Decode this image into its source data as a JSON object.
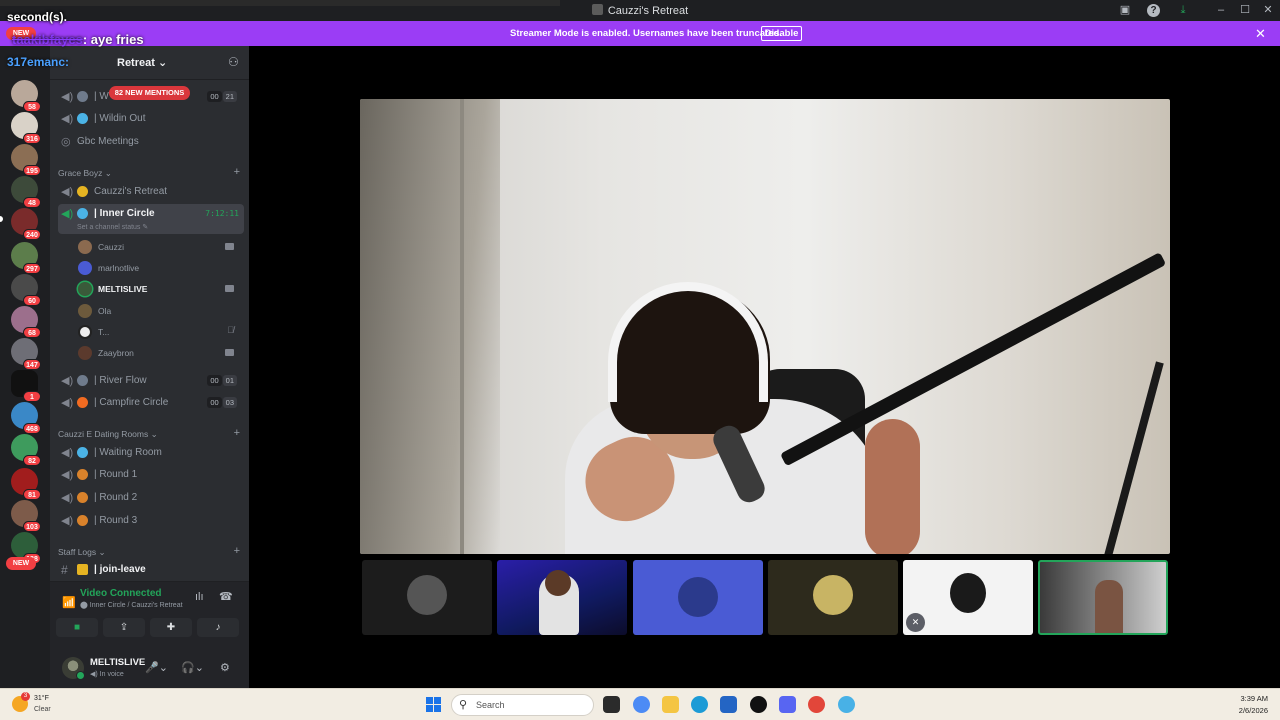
{
  "window": {
    "title": "Cauzzi's Retreat"
  },
  "banner": {
    "text": "Streamer Mode is enabled. Usernames have been truncated.",
    "button": "Disable",
    "color": "#9b3df5"
  },
  "overlay": {
    "line1": "second(s).",
    "line2_user": "taakibfayes",
    "line2_msg": "aye fries",
    "line3_user": "317emanc:"
  },
  "rail": {
    "badges": [
      "58",
      "316",
      "195",
      "48",
      "240",
      "297",
      "60",
      "68",
      "147",
      "1",
      "468",
      "82",
      "81",
      "103",
      "188"
    ],
    "new_label": "NEW"
  },
  "guild": {
    "name": "Retreat",
    "mentions": "82 NEW MENTIONS"
  },
  "channels_top": [
    {
      "name": "| W",
      "counts": [
        "00",
        "21"
      ]
    },
    {
      "name": "| Wildin Out"
    },
    {
      "name": "Gbc Meetings"
    }
  ],
  "categories": {
    "grace": "Grace Boyz",
    "dating": "Cauzzi E Dating Rooms",
    "staff": "Staff Logs"
  },
  "grace_channels": [
    {
      "name": "Cauzzi's Retreat"
    },
    {
      "name": "| Inner Circle",
      "timer": "7:12:11"
    }
  ],
  "channel_status": "Set a channel status",
  "voice_users": [
    {
      "name": "Cauzzi"
    },
    {
      "name": "marlnotlive"
    },
    {
      "name": "MELTISLIVE"
    },
    {
      "name": "Ola"
    },
    {
      "name": "T..."
    },
    {
      "name": "Zaaybron"
    }
  ],
  "more_channels": [
    {
      "name": "| River Flow",
      "counts": [
        "00",
        "01"
      ]
    },
    {
      "name": "| Campfire Circle",
      "counts": [
        "00",
        "03"
      ]
    }
  ],
  "dating_channels": [
    {
      "name": "| Waiting Room"
    },
    {
      "name": "| Round 1"
    },
    {
      "name": "| Round 2"
    },
    {
      "name": "| Round 3"
    }
  ],
  "staff_channels": [
    {
      "name": "| join-leave"
    }
  ],
  "voice_panel": {
    "status": "Video Connected",
    "sub": "Inner Circle / Cauzzi's Retreat"
  },
  "user_panel": {
    "name": "MELTISLIVE",
    "status": "In voice"
  },
  "taskbar": {
    "temp": "31°F",
    "cond": "Clear",
    "weather_badge": "3",
    "search": "Search",
    "time": "3:39 AM",
    "date": "2/6/2026"
  },
  "colors": {
    "accent_green": "#23a55a",
    "mention_red": "#da373c",
    "sidebar": "#2b2d31"
  }
}
